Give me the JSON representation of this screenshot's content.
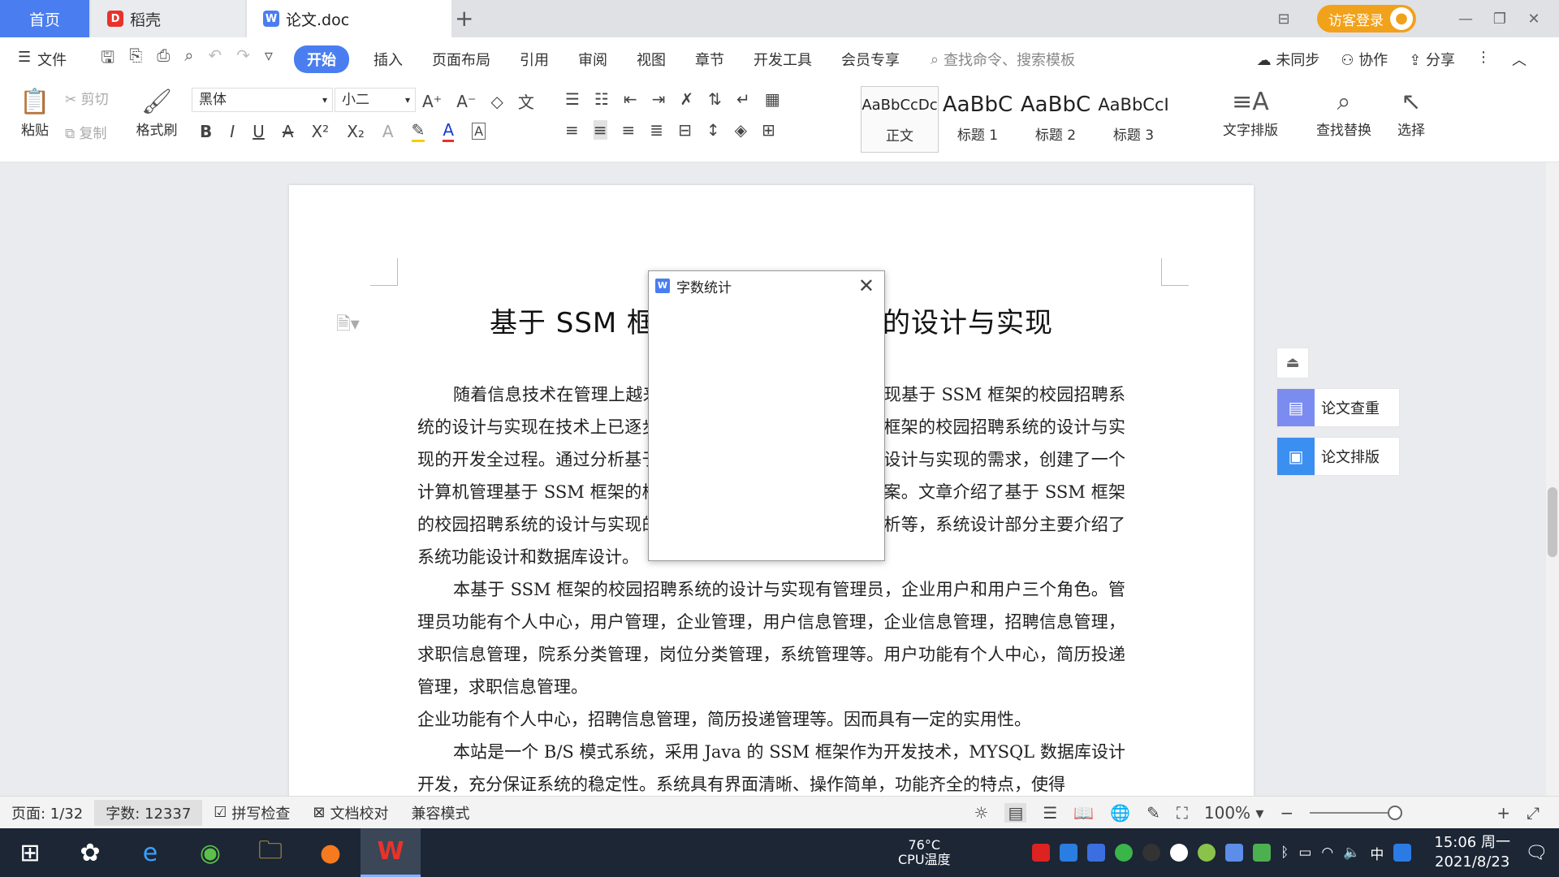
{
  "tabs": {
    "home": "首页",
    "daoke": "稻壳",
    "doc": "论文.doc",
    "login": "访客登录"
  },
  "menu": {
    "file": "文件",
    "items": [
      "开始",
      "插入",
      "页面布局",
      "引用",
      "审阅",
      "视图",
      "章节",
      "开发工具",
      "会员专享"
    ],
    "search": "查找命令、搜索模板",
    "sync": "未同步",
    "collab": "协作",
    "share": "分享"
  },
  "ribbon": {
    "paste": "粘贴",
    "cut": "剪切",
    "copy": "复制",
    "format_painter": "格式刷",
    "font_name": "黑体",
    "font_size": "小二",
    "styles": [
      {
        "sample": "AaBbCcDc",
        "label": "正文"
      },
      {
        "sample": "AaBbC",
        "label": "标题 1"
      },
      {
        "sample": "AaBbC",
        "label": "标题 2"
      },
      {
        "sample": "AaBbCcI",
        "label": "标题 3"
      }
    ],
    "text_layout": "文字排版",
    "find_replace": "查找替换",
    "select": "选择"
  },
  "document": {
    "title": "基于 SSM 框架的校园招聘系统的设计与实现",
    "paragraphs": [
      "随着信息技术在管理上越来越深入而广泛的应用，作为实现基于 SSM 框架的校园招聘系统的设计与实现在技术上已逐步成熟。本文介绍了基于 SSM 框架的校园招聘系统的设计与实现的开发全过程。通过分析基于 SSM 框架的校园招聘系统的设计与实现的需求，创建了一个计算机管理基于 SSM 框架的校园招聘系统的设计与实现的方案。文章介绍了基于 SSM 框架的校园招聘系统的设计与实现的系统分析部分，包括可行性分析等，系统设计部分主要介绍了系统功能设计和数据库设计。",
      "本基于 SSM 框架的校园招聘系统的设计与实现有管理员，企业用户和用户三个角色。管理员功能有个人中心，用户管理，企业管理，用户信息管理，企业信息管理，招聘信息管理，求职信息管理，院系分类管理，岗位分类管理，系统管理等。用户功能有个人中心，简历投递管理，求职信息管理。",
      "企业功能有个人中心，招聘信息管理，简历投递管理等。因而具有一定的实用性。",
      "本站是一个 B/S 模式系统，采用 Java 的 SSM 框架作为开发技术，MYSQL 数据库设计开发，充分保证系统的稳定性。系统具有界面清晰、操作简单，功能齐全的特点，使得"
    ]
  },
  "dialog": {
    "title": "字数统计"
  },
  "side_panel": {
    "check": "论文查重",
    "layout": "论文排版"
  },
  "status": {
    "page": "页面: 1/32",
    "word_count": "字数: 12337",
    "spell_check": "拼写检查",
    "doc_proof": "文档校对",
    "compat": "兼容模式",
    "zoom": "100%"
  },
  "taskbar": {
    "cpu_temp": "76°C",
    "cpu_label": "CPU温度",
    "ime": "中",
    "time": "15:06 周一",
    "date": "2021/8/23"
  },
  "colors": {
    "accent": "#4a7ef0",
    "login": "#f2a11a",
    "wps_red": "#e8332a"
  }
}
